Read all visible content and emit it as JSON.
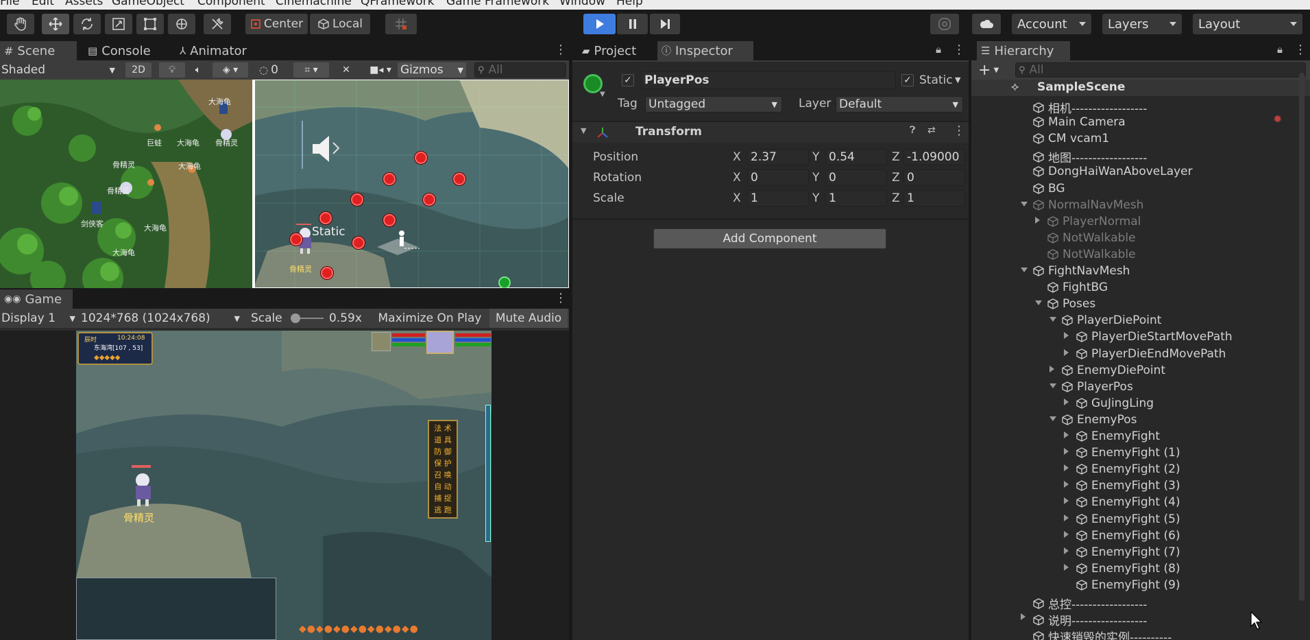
{
  "menu": [
    "File",
    "Edit",
    "Assets",
    "GameObject",
    "Component",
    "Cinemachine",
    "QFramework",
    "Game Framework",
    "Window",
    "Help"
  ],
  "toolbar": {
    "pivot_label": "Center",
    "space_label": "Local",
    "account_label": "Account",
    "layers_label": "Layers",
    "layout_label": "Layout"
  },
  "scene_panel": {
    "tabs": [
      "Scene",
      "Console",
      "Animator"
    ],
    "shading_mode": "Shaded",
    "mode_2d": "2D",
    "hidden_count": "0",
    "gizmos_label": "Gizmos",
    "search_placeholder": "All",
    "static_label": "Static",
    "map_labels": [
      "大海龟",
      "大海龟",
      "巨蛙",
      "骨精灵",
      "骨精灵",
      "大海龟",
      "骨精灵",
      "剑侠客",
      "大海龟",
      "大海龟"
    ],
    "char_label": "骨精灵"
  },
  "game_panel": {
    "tab": "Game",
    "display": "Display 1",
    "resolution": "1024*768 (1024x768)",
    "scale_label": "Scale",
    "scale_value": "0.59x",
    "maximize_label": "Maximize On Play",
    "mute_label": "Mute Audio",
    "hud_time": "10:24:08",
    "hud_sub": "辰时",
    "hud_location": "东海湾[107 , 53]",
    "char_label": "骨精灵",
    "side_menu": [
      "法 术",
      "道 具",
      "防 御",
      "保 护",
      "召 唤",
      "自 动",
      "捕 捉",
      "逃 跑"
    ]
  },
  "inspector": {
    "tabs": [
      "Project",
      "Inspector"
    ],
    "object_name": "PlayerPos",
    "static_label": "Static",
    "tag_label": "Tag",
    "tag_value": "Untagged",
    "layer_label": "Layer",
    "layer_value": "Default",
    "component_title": "Transform",
    "rows": [
      {
        "label": "Position",
        "x": "2.37",
        "y": "0.54",
        "z": "-1.09000"
      },
      {
        "label": "Rotation",
        "x": "0",
        "y": "0",
        "z": "0"
      },
      {
        "label": "Scale",
        "x": "1",
        "y": "1",
        "z": "1"
      }
    ],
    "axis_x": "X",
    "axis_y": "Y",
    "axis_z": "Z",
    "add_component": "Add Component"
  },
  "hierarchy": {
    "tab": "Hierarchy",
    "add_label": "+",
    "search_placeholder": "All",
    "scene_name": "SampleScene",
    "items": [
      {
        "name": "相机------------------",
        "depth": 1,
        "expander": "",
        "enabled": true
      },
      {
        "name": "Main Camera",
        "depth": 1,
        "expander": "",
        "enabled": true
      },
      {
        "name": "CM vcam1",
        "depth": 1,
        "expander": "",
        "enabled": true
      },
      {
        "name": "地图------------------",
        "depth": 1,
        "expander": "",
        "enabled": true
      },
      {
        "name": "DongHaiWanAboveLayer",
        "depth": 1,
        "expander": "",
        "enabled": true
      },
      {
        "name": "BG",
        "depth": 1,
        "expander": "",
        "enabled": true
      },
      {
        "name": "NormalNavMesh",
        "depth": 1,
        "expander": "open",
        "enabled": false
      },
      {
        "name": "PlayerNormal",
        "depth": 2,
        "expander": "closed",
        "enabled": false
      },
      {
        "name": "NotWalkable",
        "depth": 2,
        "expander": "",
        "enabled": false
      },
      {
        "name": "NotWalkable",
        "depth": 2,
        "expander": "",
        "enabled": false
      },
      {
        "name": "FightNavMesh",
        "depth": 1,
        "expander": "open",
        "enabled": true
      },
      {
        "name": "FightBG",
        "depth": 2,
        "expander": "",
        "enabled": true
      },
      {
        "name": "Poses",
        "depth": 2,
        "expander": "open",
        "enabled": true
      },
      {
        "name": "PlayerDiePoint",
        "depth": 3,
        "expander": "open",
        "enabled": true
      },
      {
        "name": "PlayerDieStartMovePath",
        "depth": 4,
        "expander": "closed",
        "enabled": true
      },
      {
        "name": "PlayerDieEndMovePath",
        "depth": 4,
        "expander": "closed",
        "enabled": true
      },
      {
        "name": "EnemyDiePoint",
        "depth": 3,
        "expander": "closed",
        "enabled": true
      },
      {
        "name": "PlayerPos",
        "depth": 3,
        "expander": "open",
        "enabled": true
      },
      {
        "name": "GuJingLing",
        "depth": 4,
        "expander": "closed",
        "enabled": true
      },
      {
        "name": "EnemyPos",
        "depth": 3,
        "expander": "open",
        "enabled": true
      },
      {
        "name": "EnemyFight",
        "depth": 4,
        "expander": "closed",
        "enabled": true
      },
      {
        "name": "EnemyFight (1)",
        "depth": 4,
        "expander": "closed",
        "enabled": true
      },
      {
        "name": "EnemyFight (2)",
        "depth": 4,
        "expander": "closed",
        "enabled": true
      },
      {
        "name": "EnemyFight (3)",
        "depth": 4,
        "expander": "closed",
        "enabled": true
      },
      {
        "name": "EnemyFight (4)",
        "depth": 4,
        "expander": "closed",
        "enabled": true
      },
      {
        "name": "EnemyFight (5)",
        "depth": 4,
        "expander": "closed",
        "enabled": true
      },
      {
        "name": "EnemyFight (6)",
        "depth": 4,
        "expander": "closed",
        "enabled": true
      },
      {
        "name": "EnemyFight (7)",
        "depth": 4,
        "expander": "closed",
        "enabled": true
      },
      {
        "name": "EnemyFight (8)",
        "depth": 4,
        "expander": "closed",
        "enabled": true
      },
      {
        "name": "EnemyFight (9)",
        "depth": 4,
        "expander": "",
        "enabled": true
      },
      {
        "name": "总控------------------",
        "depth": 1,
        "expander": "",
        "enabled": true
      },
      {
        "name": "说明------------------",
        "depth": 1,
        "expander": "closed",
        "enabled": true
      },
      {
        "name": "快速销毁的实例----------",
        "depth": 1,
        "expander": "",
        "enabled": true
      }
    ]
  },
  "colors": {
    "accent_blue": "#3e7ce0",
    "panel_bg": "#282828",
    "header_bg": "#3c3c3c",
    "marker_red": "#e02020",
    "marker_green": "#18a028"
  }
}
